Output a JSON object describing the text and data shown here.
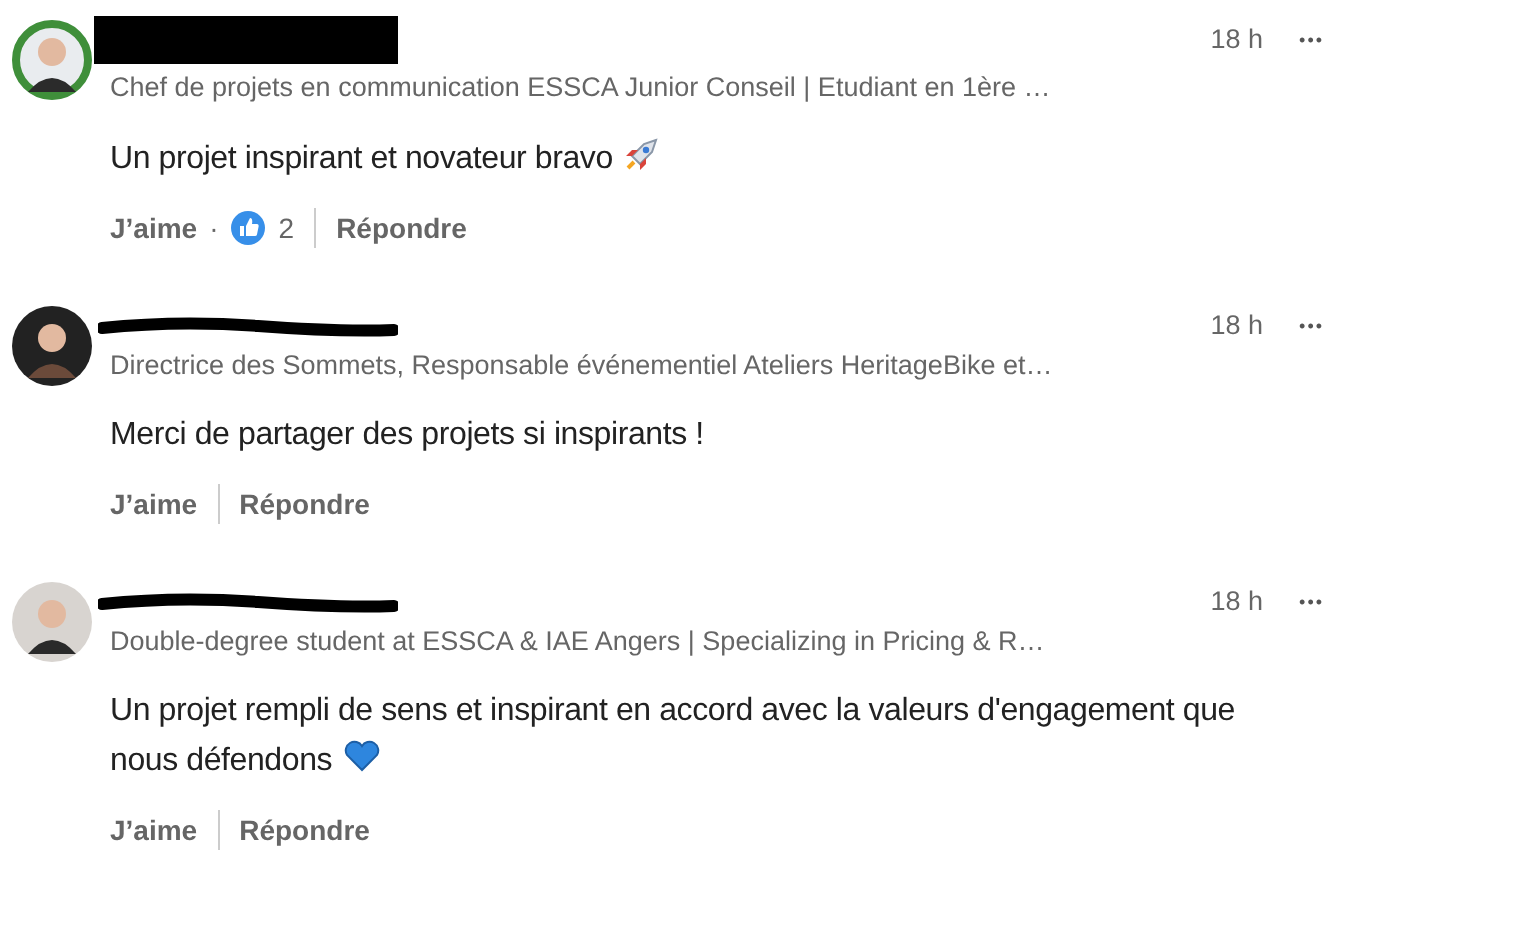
{
  "comments": [
    {
      "name": {
        "kind": "block"
      },
      "headline": "Chef de projets en communication ESSCA Junior Conseil | Etudiant en 1ère …",
      "time": "18 h",
      "more": "•••",
      "text": "Un projet inspirant et novateur bravo",
      "emoji": {
        "kind": "rocket"
      },
      "actions": {
        "like": "J’aime",
        "separator": "·",
        "reaction_count": "2",
        "reply": "Répondre"
      }
    },
    {
      "name": {
        "kind": "scribble"
      },
      "headline": "Directrice des Sommets, Responsable événementiel Ateliers HeritageBike et…",
      "time": "18 h",
      "more": "•••",
      "text": "Merci de partager des projets si inspirants !",
      "actions": {
        "like": "J’aime",
        "reply": "Répondre"
      }
    },
    {
      "name": {
        "kind": "scribble"
      },
      "headline": "Double-degree student at ESSCA & IAE Angers | Specializing in Pricing & R…",
      "time": "18 h",
      "more": "•••",
      "text": "Un projet rempli de sens et inspirant en accord avec la valeurs d'engagement que nous défendons",
      "emoji": {
        "kind": "heart"
      },
      "actions": {
        "like": "J’aime",
        "reply": "Répondre"
      }
    }
  ]
}
